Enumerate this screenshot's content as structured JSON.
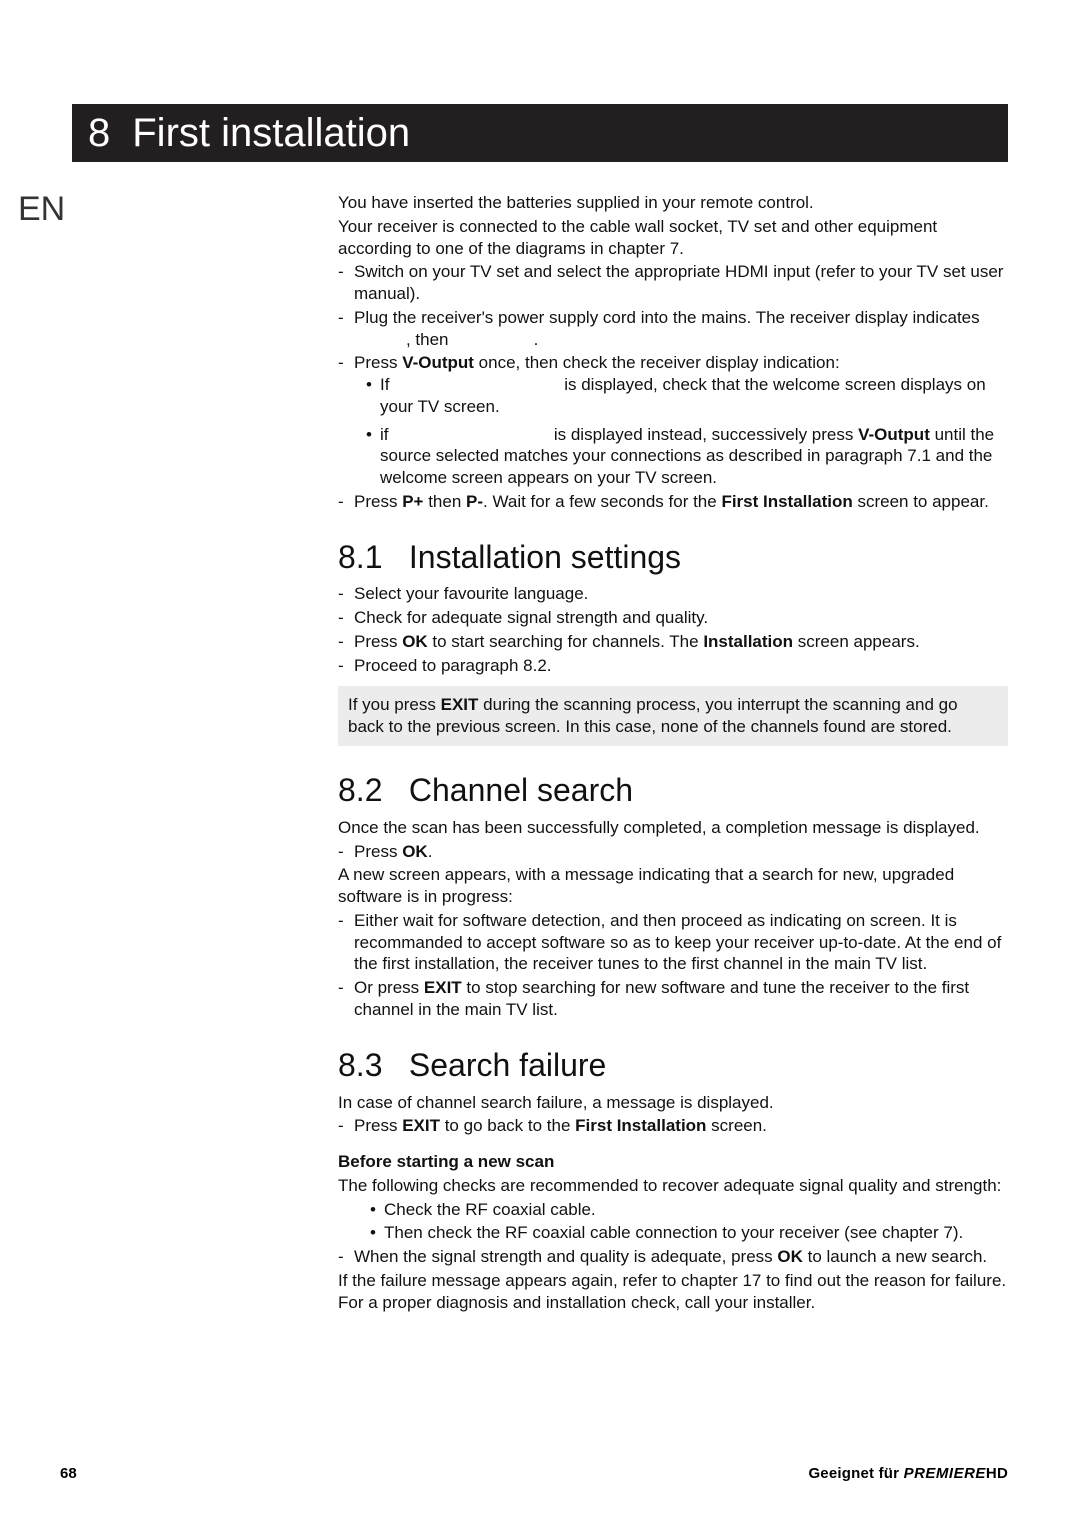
{
  "lang": "EN",
  "chapter": {
    "num": "8",
    "title": "First installation"
  },
  "intro": {
    "p1": "You have inserted the batteries supplied in your remote control.",
    "p2": "Your receiver is connected to the cable wall socket, TV set and other equipment according to one of the diagrams in chapter 7.",
    "d1": "Switch on your TV set and select the appropriate HDMI input (refer to your TV set user manual).",
    "d2a": "Plug the receiver's power supply cord into the mains. The receiver display indicates",
    "d2b": ", then",
    "d2c": ".",
    "d3_lead": "Press ",
    "d3_key": "V-Output",
    "d3_tail": " once, then check the receiver display indication:",
    "d3_b1_a": "If ",
    "d3_b1_b": " is displayed, check that the welcome screen displays on your TV screen.",
    "d3_b2_a": "if ",
    "d3_b2_b": " is displayed instead, successively press ",
    "d3_b2_key": "V-Output",
    "d3_b2_c": " until the source selected matches your connections as described in paragraph 7.1 and the welcome screen appears on your TV screen.",
    "d4_a": "Press ",
    "d4_k1": "P+",
    "d4_b": " then ",
    "d4_k2": "P-",
    "d4_c": ". Wait for a few seconds for the ",
    "d4_k3": "First Installation",
    "d4_d": " screen to appear."
  },
  "s81": {
    "num": "8.1",
    "title": "Installation settings",
    "li1": "Select your favourite language.",
    "li2": "Check for adequate signal strength and quality.",
    "li3a": "Press ",
    "li3k": "OK",
    "li3b": " to start searching for channels. The ",
    "li3k2": "Installation",
    "li3c": " screen appears.",
    "li4": "Proceed to paragraph 8.2.",
    "note_a": "If you press ",
    "note_k": "EXIT",
    "note_b": " during the scanning process, you interrupt the scanning and go back to the previous screen. In this case, none of the channels found are stored."
  },
  "s82": {
    "num": "8.2",
    "title": "Channel search",
    "p1": "Once the scan has been successfully completed, a completion message is displayed.",
    "d1a": "Press ",
    "d1k": "OK",
    "d1b": ".",
    "p2": "A new screen appears, with a message indicating that a search for new, upgraded software is in progress:",
    "d2": "Either wait for software detection, and then proceed as indicating on screen. It is recommanded to accept software so as to keep your receiver up-to-date. At the end of the first installation, the receiver tunes to the first channel in the main TV list.",
    "d3a": "Or press ",
    "d3k": "EXIT",
    "d3b": " to stop searching for new software and tune the receiver to the first channel in the main TV list."
  },
  "s83": {
    "num": "8.3",
    "title": "Search failure",
    "p1": "In case of channel search failure, a message is displayed.",
    "d1a": "Press ",
    "d1k": "EXIT",
    "d1b": " to go back to the ",
    "d1k2": "First Installation",
    "d1c": " screen.",
    "sub": "Before starting a new scan",
    "p2": "The following checks are recommended to recover adequate signal quality and strength:",
    "b1": "Check the RF coaxial cable.",
    "b2": "Then check the RF coaxial cable connection to your receiver (see chapter 7).",
    "d2a": "When the signal strength and quality is adequate, press ",
    "d2k": "OK",
    "d2b": " to launch a new search.",
    "p3": "If the failure message appears again, refer to chapter 17 to find out the reason for failure. For a proper diagnosis and installation check, call your installer."
  },
  "footer": {
    "page": "68",
    "label": "Geeignet für ",
    "brand1": "PREMIERE",
    "brand2": "HD"
  }
}
